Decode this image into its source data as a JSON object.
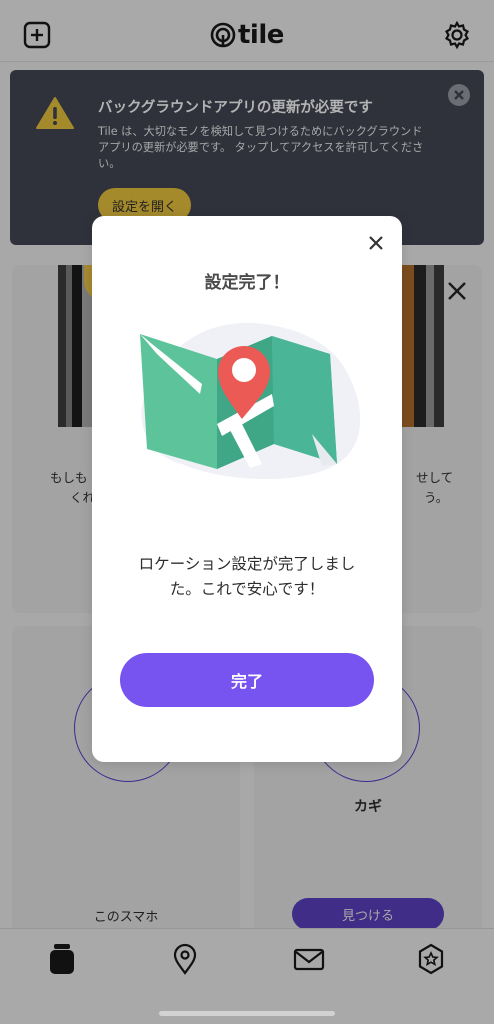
{
  "header": {
    "logo_text": "tile",
    "add_icon": "plus-square-icon",
    "settings_icon": "gear-icon"
  },
  "banner": {
    "title": "バックグラウンドアプリの更新が必要です",
    "body": "Tile は、大切なモノを検知して見つけるためにバックグラウンドアプリの更新が必要です。 タップしてアクセスを許可してください。",
    "button_label": "設定を開く",
    "warning_icon": "warning-icon",
    "close_icon": "close-icon",
    "colors": {
      "background": "#2f323b",
      "button": "#a58a2c"
    }
  },
  "cards": {
    "card_a_text_line1": "もしも",
    "card_a_text_line2": "くれ",
    "card_b_text_line1": "せして",
    "card_b_text_line2": "う。",
    "card_c_label": "このスマホ",
    "card_d_label": "カギ",
    "find_button_label": "見つける"
  },
  "modal": {
    "title": "設定完了！",
    "message_line1": "ロケーション設定が完了しまし",
    "message_line2": "た。これで安心です！",
    "done_label": "完了",
    "close_icon": "close-icon",
    "illustration": "map-pin-illustration",
    "colors": {
      "primary": "#7754ef",
      "pin": "#ec5a55",
      "map": "#5ec29c"
    }
  },
  "tabbar": {
    "items": [
      {
        "icon": "tile-device-icon"
      },
      {
        "icon": "location-pin-icon"
      },
      {
        "icon": "mail-icon"
      },
      {
        "icon": "star-badge-icon"
      }
    ]
  }
}
